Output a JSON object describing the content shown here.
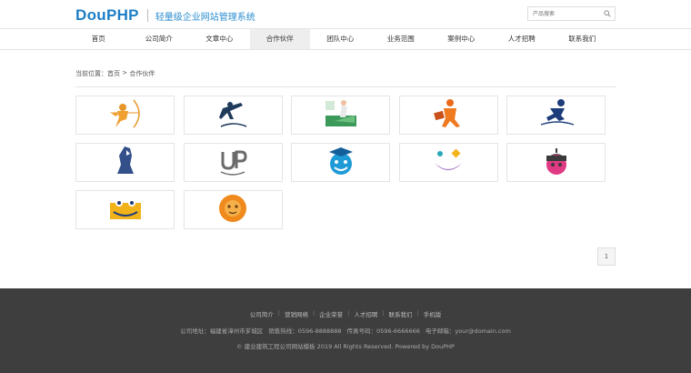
{
  "header": {
    "logo_text": "DouPHP",
    "tagline": "轻量级企业网站管理系统",
    "search_placeholder": "产品搜索"
  },
  "nav": {
    "items": [
      {
        "label": "首页"
      },
      {
        "label": "公司简介"
      },
      {
        "label": "文章中心"
      },
      {
        "label": "合作伙伴",
        "active": true
      },
      {
        "label": "团队中心"
      },
      {
        "label": "业务范围"
      },
      {
        "label": "案例中心"
      },
      {
        "label": "人才招聘"
      },
      {
        "label": "联系我们"
      }
    ]
  },
  "breadcrumb": {
    "prefix": "当前位置：",
    "home": "首页",
    "sep": " > ",
    "current": "合作伙伴"
  },
  "partners": [
    {
      "logo": "orange-archer-icon"
    },
    {
      "logo": "navy-sprinter-icon"
    },
    {
      "logo": "green-landscape-figure-icon"
    },
    {
      "logo": "orange-runner-with-bag-icon"
    },
    {
      "logo": "blue-runner-icon"
    },
    {
      "logo": "blue-standing-figure-icon"
    },
    {
      "logo": "up-smile-icon"
    },
    {
      "logo": "graduate-smiley-icon"
    },
    {
      "logo": "smiley-face-icon"
    },
    {
      "logo": "acorn-face-icon"
    },
    {
      "logo": "yellow-smile-box-icon"
    },
    {
      "logo": "orange-lion-icon"
    }
  ],
  "pager": {
    "current": "1"
  },
  "footer": {
    "links": [
      "公司简介",
      "营销网络",
      "企业荣誉",
      "人才招聘",
      "联系我们",
      "手机版"
    ],
    "address": "公司地址：福建省漳州市芗城区",
    "hotline": "销售热线：0596-8888888",
    "fax": "传真号码：0596-6666666",
    "email": "电子邮箱：your@domain.com",
    "copyright": "© 建业建筑工程公司网站模板 2019 All Rights Reserved. Powered by DouPHP"
  }
}
